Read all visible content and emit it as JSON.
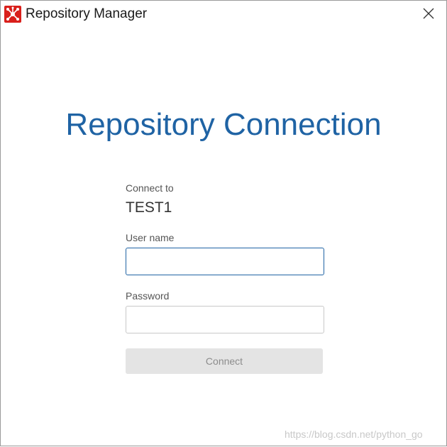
{
  "window": {
    "title": "Repository Manager",
    "icon": "repository-manager-app-icon",
    "close_icon": "close-icon"
  },
  "main": {
    "heading": "Repository Connection",
    "connect_to_label": "Connect to",
    "connect_to_value": "TEST1",
    "username": {
      "label": "User name",
      "value": "",
      "placeholder": ""
    },
    "password": {
      "label": "Password",
      "value": "",
      "placeholder": ""
    },
    "connect_button_label": "Connect"
  },
  "watermark": "https://blog.csdn.net/python_go",
  "colors": {
    "accent": "#1f63a4",
    "app_icon": "#d9201c",
    "button_disabled_bg": "#e4e4e4",
    "button_disabled_text": "#8c8c8c"
  }
}
